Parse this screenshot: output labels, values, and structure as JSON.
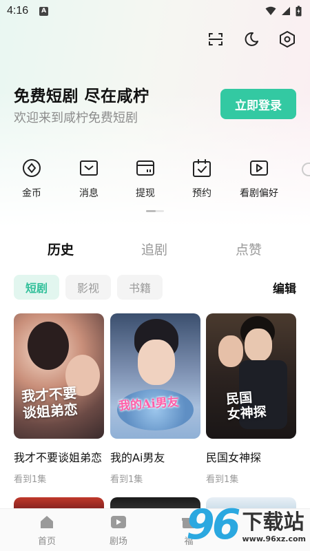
{
  "status_bar": {
    "time": "4:16",
    "notif_badge": "A"
  },
  "top_actions": [
    "scan-icon",
    "moon-icon",
    "settings-hexagon-icon"
  ],
  "hero": {
    "title": "免费短剧 尽在咸柠",
    "subtitle": "欢迎来到咸柠免费短剧",
    "login_label": "立即登录"
  },
  "quick_menu": [
    {
      "label": "金币",
      "icon": "coin-icon"
    },
    {
      "label": "消息",
      "icon": "message-icon"
    },
    {
      "label": "提现",
      "icon": "wallet-icon"
    },
    {
      "label": "预约",
      "icon": "calendar-icon"
    },
    {
      "label": "看剧偏好",
      "icon": "play-icon"
    }
  ],
  "tabs": [
    {
      "label": "历史",
      "active": true
    },
    {
      "label": "追剧",
      "active": false
    },
    {
      "label": "点赞",
      "active": false
    }
  ],
  "filters": [
    {
      "label": "短剧",
      "active": true
    },
    {
      "label": "影视",
      "active": false
    },
    {
      "label": "书籍",
      "active": false
    }
  ],
  "edit_label": "编辑",
  "history": [
    {
      "title": "我才不要谈姐弟恋",
      "progress": "看到1集",
      "poster_text": "我才不要\n谈姐弟恋"
    },
    {
      "title": "我的Ai男友",
      "progress": "看到1集",
      "poster_text": "我的Ai男友"
    },
    {
      "title": "民国女神探",
      "progress": "看到1集",
      "poster_text": "民国\n女神探"
    }
  ],
  "bottom_nav": [
    {
      "label": "首页",
      "icon": "home-icon"
    },
    {
      "label": "剧场",
      "icon": "theater-icon"
    },
    {
      "label": "福",
      "icon": "gift-icon"
    }
  ],
  "watermark": {
    "digits": "96",
    "text": "下载站",
    "url": "www.96xz.com"
  },
  "colors": {
    "accent": "#33c9a2",
    "accent_light": "#e2f6ef",
    "muted": "#999999"
  }
}
